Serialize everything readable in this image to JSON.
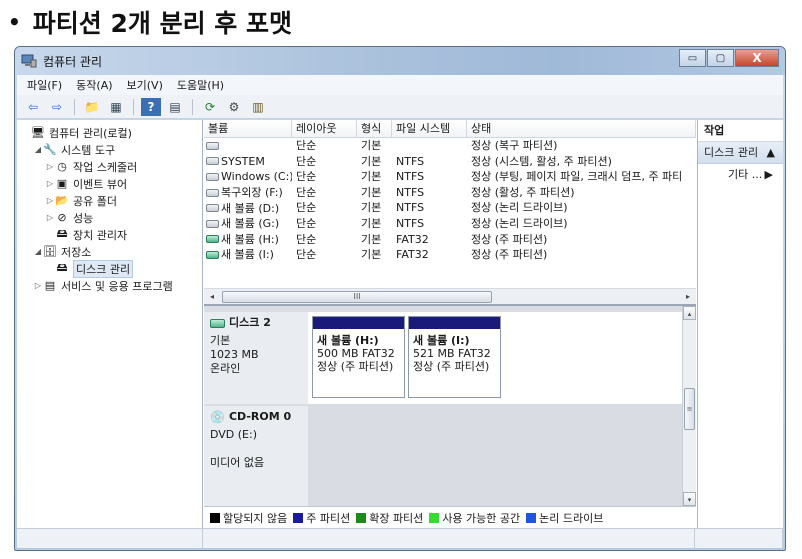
{
  "slide": {
    "bullet": "•",
    "title": "파티션 2개 분리 후 포맷"
  },
  "window": {
    "title": "컴퓨터 관리",
    "controls": {
      "minimize": "▭",
      "maximize": "▢",
      "close": "X"
    }
  },
  "menu": [
    "파일(F)",
    "동작(A)",
    "보기(V)",
    "도움말(H)"
  ],
  "toolbar": [
    {
      "icon": "back-arrow-icon",
      "glyph": "⇦"
    },
    {
      "icon": "forward-arrow-icon",
      "glyph": "⇨"
    },
    {
      "icon": "up-folder-icon",
      "glyph": "📁"
    },
    {
      "icon": "show-tree-icon",
      "glyph": "▦"
    },
    {
      "icon": "help-icon",
      "glyph": "?"
    },
    {
      "icon": "properties-icon",
      "glyph": "▤"
    },
    {
      "icon": "refresh-icon",
      "glyph": "⟳"
    },
    {
      "icon": "settings-icon",
      "glyph": "⚙"
    },
    {
      "icon": "export-list-icon",
      "glyph": "▥"
    }
  ],
  "tree": [
    {
      "label": "컴퓨터 관리(로컬)",
      "arrow": "",
      "indent": 0,
      "icon": "computer-icon",
      "glyph": "🖥"
    },
    {
      "label": "시스템 도구",
      "arrow": "◢",
      "indent": 1,
      "icon": "tools-icon",
      "glyph": "🔧"
    },
    {
      "label": "작업 스케줄러",
      "arrow": "▷",
      "indent": 2,
      "icon": "clock-icon",
      "glyph": "◷"
    },
    {
      "label": "이벤트 뷰어",
      "arrow": "▷",
      "indent": 2,
      "icon": "event-viewer-icon",
      "glyph": "▣"
    },
    {
      "label": "공유 폴더",
      "arrow": "▷",
      "indent": 2,
      "icon": "shared-folder-icon",
      "glyph": "📂"
    },
    {
      "label": "성능",
      "arrow": "▷",
      "indent": 2,
      "icon": "performance-icon",
      "glyph": "⊘"
    },
    {
      "label": "장치 관리자",
      "arrow": "",
      "indent": 2,
      "icon": "device-manager-icon",
      "glyph": "🖴"
    },
    {
      "label": "저장소",
      "arrow": "◢",
      "indent": 1,
      "icon": "storage-icon",
      "glyph": "🗄"
    },
    {
      "label": "디스크 관리",
      "arrow": "",
      "indent": 2,
      "icon": "disk-management-icon",
      "glyph": "🖴",
      "selected": true
    },
    {
      "label": "서비스 및 응용 프로그램",
      "arrow": "▷",
      "indent": 1,
      "icon": "services-icon",
      "glyph": "▤"
    }
  ],
  "volume_table": {
    "columns": [
      "볼륨",
      "레이아웃",
      "형식",
      "파일 시스템",
      "상태"
    ],
    "rows": [
      {
        "volume": "",
        "layout": "단순",
        "type": "기본",
        "fs": "",
        "status": "정상 (복구 파티션)",
        "green": false
      },
      {
        "volume": "SYSTEM",
        "layout": "단순",
        "type": "기본",
        "fs": "NTFS",
        "status": "정상 (시스템, 활성, 주 파티션)",
        "green": false
      },
      {
        "volume": "Windows (C:)",
        "layout": "단순",
        "type": "기본",
        "fs": "NTFS",
        "status": "정상 (부팅, 페이지 파일, 크래시 덤프, 주 파티",
        "green": false
      },
      {
        "volume": "복구외장 (F:)",
        "layout": "단순",
        "type": "기본",
        "fs": "NTFS",
        "status": "정상 (활성, 주 파티션)",
        "green": false
      },
      {
        "volume": "새 볼륨 (D:)",
        "layout": "단순",
        "type": "기본",
        "fs": "NTFS",
        "status": "정상 (논리 드라이브)",
        "green": false
      },
      {
        "volume": "새 볼륨 (G:)",
        "layout": "단순",
        "type": "기본",
        "fs": "NTFS",
        "status": "정상 (논리 드라이브)",
        "green": false
      },
      {
        "volume": "새 볼륨 (H:)",
        "layout": "단순",
        "type": "기본",
        "fs": "FAT32",
        "status": "정상 (주 파티션)",
        "green": true
      },
      {
        "volume": "새 볼륨 (I:)",
        "layout": "단순",
        "type": "기본",
        "fs": "FAT32",
        "status": "정상 (주 파티션)",
        "green": true
      }
    ],
    "hscroll_thumb": "III",
    "hscroll_left": "◂",
    "hscroll_right": "▸"
  },
  "disks": {
    "disk2": {
      "name": "디스크 2",
      "type": "기본",
      "size": "1023 MB",
      "state": "온라인",
      "partitions": [
        {
          "name": "새 볼륨  (H:)",
          "size": "500 MB FAT32",
          "status": "정상 (주 파티션)"
        },
        {
          "name": "새 볼륨  (I:)",
          "size": "521 MB FAT32",
          "status": "정상 (주 파티션)"
        }
      ]
    },
    "cdrom": {
      "name": "CD-ROM 0",
      "drive": "DVD (E:)",
      "media": "미디어 없음"
    }
  },
  "vscroll": {
    "up": "▴",
    "down": "▾",
    "thumb": "≡"
  },
  "legend": [
    {
      "label": "할당되지 않음",
      "color": "#000000"
    },
    {
      "label": "주 파티션",
      "color": "#1a1a9e"
    },
    {
      "label": "확장 파티션",
      "color": "#1a8a1a"
    },
    {
      "label": "사용 가능한 공간",
      "color": "#33dd33"
    },
    {
      "label": "논리 드라이브",
      "color": "#2255dd"
    }
  ],
  "actions": {
    "header": "작업",
    "selected": {
      "label": "디스크 관리",
      "arrow": "▲"
    },
    "item": {
      "label": "기타 ...",
      "arrow": "▶"
    }
  }
}
